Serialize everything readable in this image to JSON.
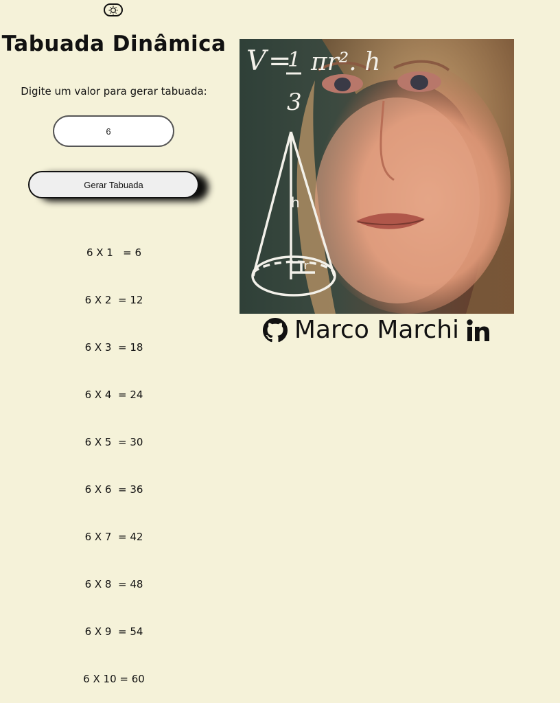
{
  "header": {
    "title": "Tabuada Dinâmica",
    "prompt": "Digite um valor para gerar tabuada:"
  },
  "controls": {
    "input_value": "6",
    "button_label": "Gerar Tabuada",
    "theme_toggle_icon": "sun-icon"
  },
  "table": {
    "rows": [
      "6 X 1   = 6",
      "6 X 2  = 12",
      "6 X 3  = 18",
      "6 X 4  = 24",
      "6 X 5  = 30",
      "6 X 6  = 36",
      "6 X 7  = 42",
      "6 X 8  = 48",
      "6 X 9  = 54",
      "6 X 10 = 60"
    ]
  },
  "image": {
    "formula_v": "V",
    "formula_eq": "=",
    "formula_num": "1",
    "formula_den": "3",
    "formula_rest": "πr². h",
    "label_h": "h",
    "label_r": "r"
  },
  "footer": {
    "name": "Marco Marchi",
    "github_icon": "github-icon",
    "linkedin_icon": "linkedin-icon"
  },
  "colors": {
    "background": "#f5f2d9",
    "text": "#111111",
    "button_bg": "#efefef"
  }
}
